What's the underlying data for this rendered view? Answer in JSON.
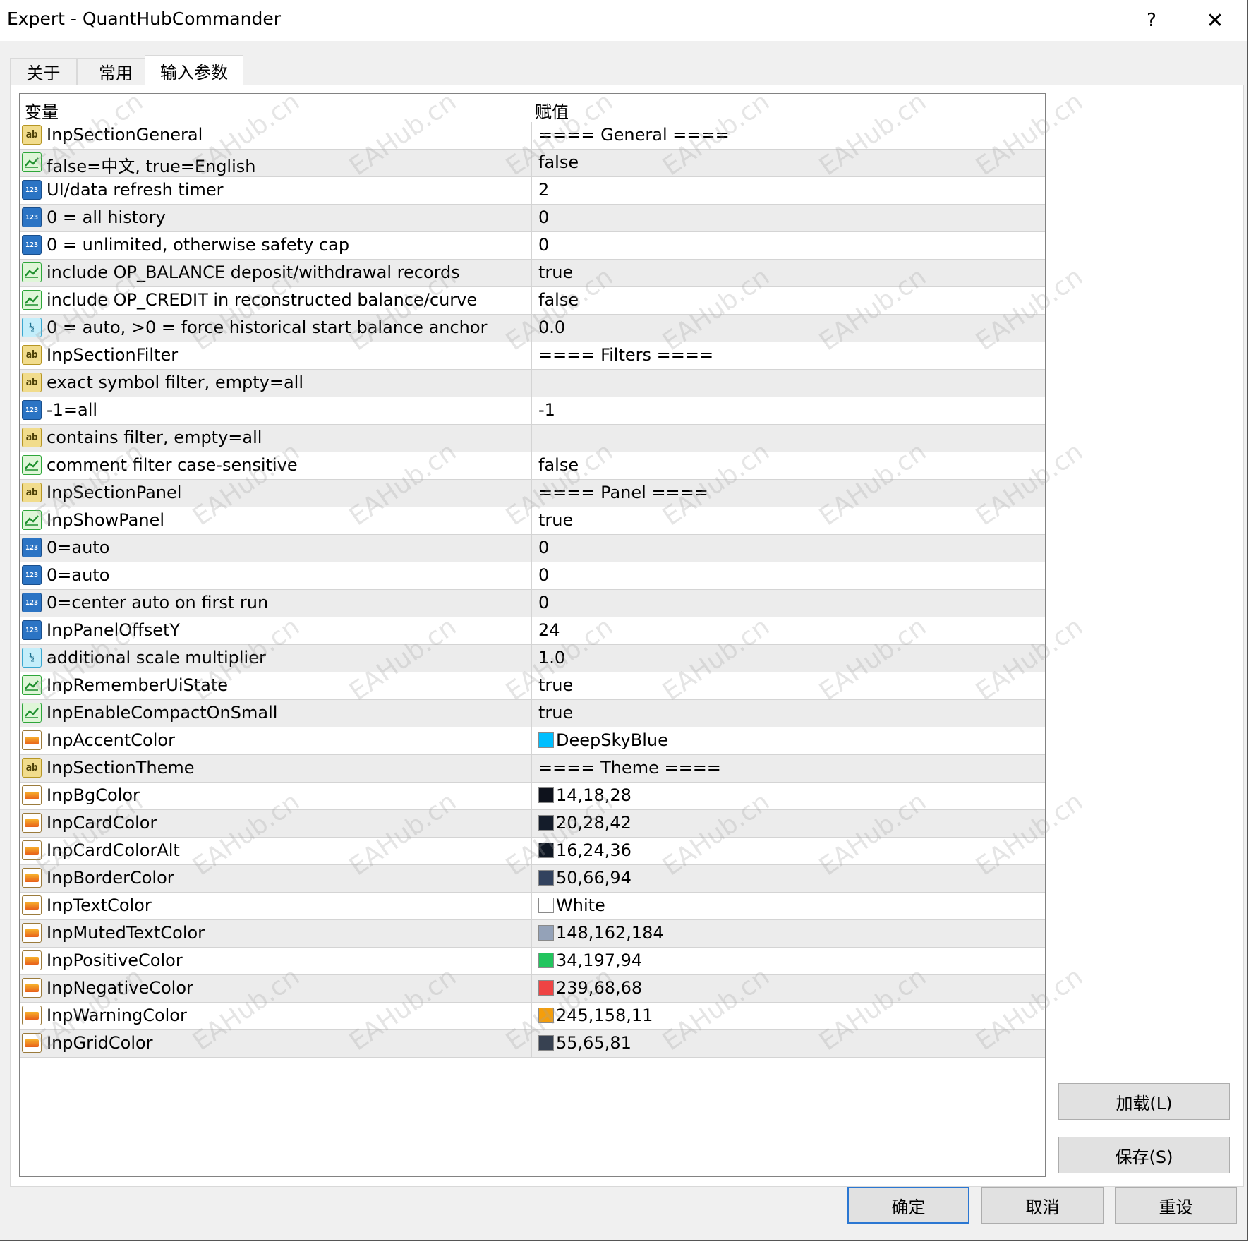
{
  "window": {
    "title": "Expert - QuantHubCommander",
    "help_label": "?",
    "close_label": "✕"
  },
  "tabs": [
    {
      "label": "关于"
    },
    {
      "label": "常用"
    },
    {
      "label": "输入参数"
    }
  ],
  "grid": {
    "headers": {
      "variable": "变量",
      "value": "赋值"
    },
    "rows": [
      {
        "type": "string",
        "variable": "InpSectionGeneral",
        "value": "==== General ===="
      },
      {
        "type": "bool",
        "variable": "false=中文, true=English",
        "value": "false"
      },
      {
        "type": "int",
        "variable": "UI/data refresh timer",
        "value": "2"
      },
      {
        "type": "int",
        "variable": "0 = all history",
        "value": "0"
      },
      {
        "type": "int",
        "variable": "0 = unlimited, otherwise safety cap",
        "value": "0"
      },
      {
        "type": "bool",
        "variable": "include OP_BALANCE deposit/withdrawal records",
        "value": "true"
      },
      {
        "type": "bool",
        "variable": "include OP_CREDIT in reconstructed balance/curve",
        "value": "false"
      },
      {
        "type": "double",
        "variable": "0 = auto, >0 = force historical start balance anchor",
        "value": "0.0"
      },
      {
        "type": "string",
        "variable": "InpSectionFilter",
        "value": "==== Filters ===="
      },
      {
        "type": "string",
        "variable": "exact symbol filter, empty=all",
        "value": ""
      },
      {
        "type": "int",
        "variable": "-1=all",
        "value": "-1"
      },
      {
        "type": "string",
        "variable": "contains filter, empty=all",
        "value": ""
      },
      {
        "type": "bool",
        "variable": "comment filter case-sensitive",
        "value": "false"
      },
      {
        "type": "string",
        "variable": "InpSectionPanel",
        "value": "==== Panel ===="
      },
      {
        "type": "bool",
        "variable": "InpShowPanel",
        "value": "true"
      },
      {
        "type": "int",
        "variable": "0=auto",
        "value": "0"
      },
      {
        "type": "int",
        "variable": "0=auto",
        "value": "0"
      },
      {
        "type": "int",
        "variable": "0=center auto on first run",
        "value": "0"
      },
      {
        "type": "int",
        "variable": "InpPanelOffsetY",
        "value": "24"
      },
      {
        "type": "double",
        "variable": "additional scale multiplier",
        "value": "1.0"
      },
      {
        "type": "bool",
        "variable": "InpRememberUiState",
        "value": "true"
      },
      {
        "type": "bool",
        "variable": "InpEnableCompactOnSmall",
        "value": "true"
      },
      {
        "type": "color",
        "variable": "InpAccentColor",
        "value": "DeepSkyBlue",
        "swatch": "#00bfff"
      },
      {
        "type": "string",
        "variable": "InpSectionTheme",
        "value": "==== Theme ===="
      },
      {
        "type": "color",
        "variable": "InpBgColor",
        "value": "14,18,28",
        "swatch": "#0e121c"
      },
      {
        "type": "color",
        "variable": "InpCardColor",
        "value": "20,28,42",
        "swatch": "#141c2a"
      },
      {
        "type": "color",
        "variable": "InpCardColorAlt",
        "value": "16,24,36",
        "swatch": "#101824"
      },
      {
        "type": "color",
        "variable": "InpBorderColor",
        "value": "50,66,94",
        "swatch": "#32425e"
      },
      {
        "type": "color",
        "variable": "InpTextColor",
        "value": "White",
        "swatch": "#ffffff"
      },
      {
        "type": "color",
        "variable": "InpMutedTextColor",
        "value": "148,162,184",
        "swatch": "#94a2b8"
      },
      {
        "type": "color",
        "variable": "InpPositiveColor",
        "value": "34,197,94",
        "swatch": "#22c55e"
      },
      {
        "type": "color",
        "variable": "InpNegativeColor",
        "value": "239,68,68",
        "swatch": "#ef4444"
      },
      {
        "type": "color",
        "variable": "InpWarningColor",
        "value": "245,158,11",
        "swatch": "#f59e0b"
      },
      {
        "type": "color",
        "variable": "InpGridColor",
        "value": "55,65,81",
        "swatch": "#374151"
      }
    ]
  },
  "buttons": {
    "load": "加载(L)",
    "save": "保存(S)",
    "ok": "确定",
    "cancel": "取消",
    "reset": "重设"
  },
  "icons": {
    "string": "ab",
    "int": "123",
    "double": "½",
    "bool": "bool-icon",
    "color": "color-icon"
  },
  "watermark": "EAHub.cn"
}
